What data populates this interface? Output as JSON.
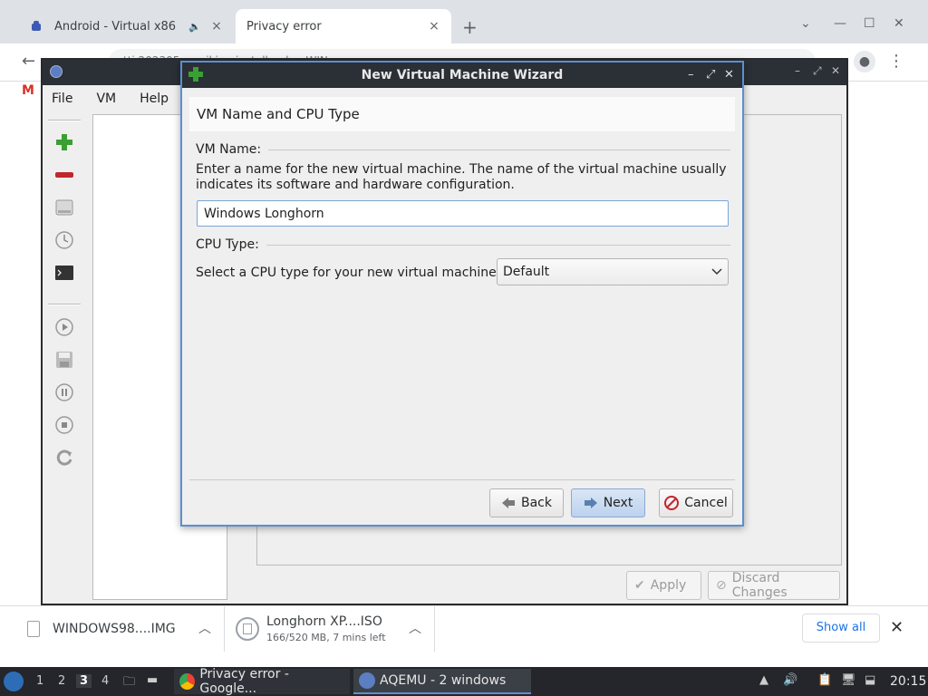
{
  "browser": {
    "tabs": [
      {
        "label": "Android - Virtual x86",
        "close": "×"
      },
      {
        "label": "Privacy error",
        "close": "×"
      }
    ],
    "new_tab": "+",
    "window_controls": {
      "dropdown": "⌄",
      "minimize": "—",
      "maximize": "☐",
      "close": "✕"
    },
    "back": "←",
    "url": "tti 202305 ... wiki ... installand ... WIN",
    "bookmark_gmail": "M"
  },
  "aqemu": {
    "menu": {
      "file": "File",
      "vm": "VM",
      "help": "Help"
    },
    "buttons": {
      "apply": "Apply",
      "discard": "Discard Changes"
    }
  },
  "wizard": {
    "title": "New Virtual Machine Wizard",
    "controls": {
      "minimize": "–",
      "maximize": "⤢",
      "close": "✕"
    },
    "header": "VM Name and CPU Type",
    "vm_name_group": "VM Name:",
    "vm_name_description": "Enter a name for the new virtual machine. The name of the virtual machine usually indicates its software and hardware configuration.",
    "vm_name_value": "Windows Longhorn",
    "cpu_group": "CPU Type:",
    "cpu_label": "Select a CPU type for your new virtual machine:",
    "cpu_selected": "Default",
    "back_label": "Back",
    "next_label": "Next",
    "cancel_label": "Cancel"
  },
  "downloads": {
    "items": [
      {
        "name": "WINDOWS98....IMG"
      },
      {
        "name": "Longhorn XP....ISO",
        "status": "166/520 MB, 7 mins left"
      }
    ],
    "show_all": "Show all",
    "close": "✕"
  },
  "taskbar": {
    "workspaces": [
      "1",
      "2",
      "3",
      "4"
    ],
    "active_workspace": "3",
    "tasks": [
      {
        "label": "Privacy error - Google..."
      },
      {
        "label": "AQEMU - 2 windows"
      }
    ],
    "clock": "20:15"
  },
  "colors": {
    "accent": "#5b8fd0",
    "titlebar": "#2b2f36",
    "taskbar": "#24262b",
    "link": "#1a73e8"
  }
}
